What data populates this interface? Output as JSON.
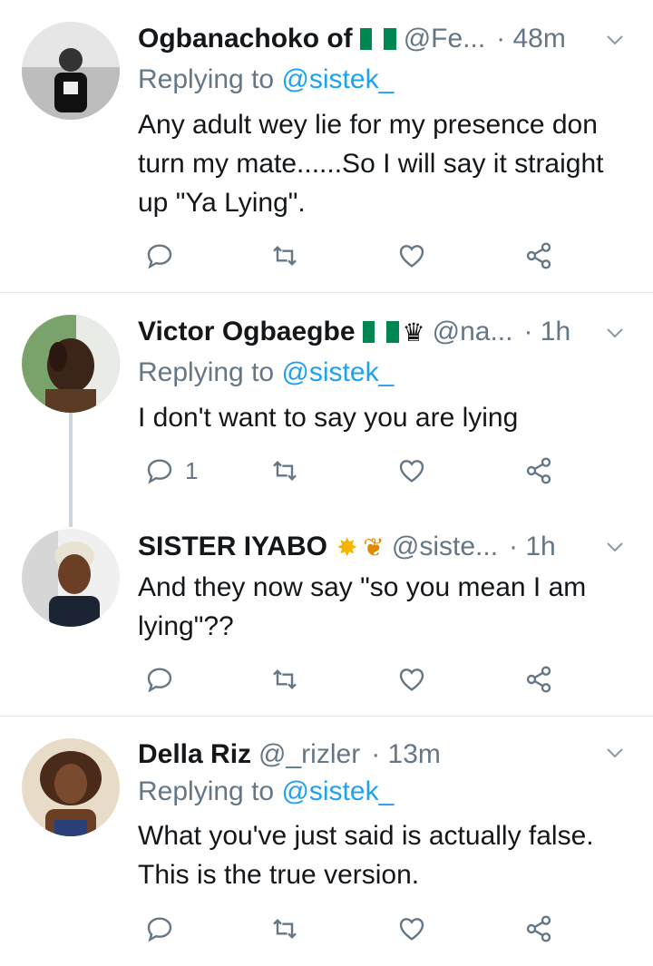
{
  "tweets": [
    {
      "name": "Ogbanachoko of",
      "handle": "@Fe...",
      "time": "· 48m",
      "reply_prefix": "Replying to",
      "reply_to": "@sistek_",
      "body": "Any adult wey lie for my presence don turn my mate......So I will say it straight up \"Ya Lying\".",
      "reply_count": ""
    },
    {
      "name": "Victor Ogbaegbe",
      "handle": "@na...",
      "time": "· 1h",
      "reply_prefix": "Replying to",
      "reply_to": "@sistek_",
      "body": "I don't want to say you are lying",
      "reply_count": "1"
    },
    {
      "name": "SISTER IYABO",
      "handle": "@siste...",
      "time": "· 1h",
      "body": "And they now say \"so you mean I am lying\"??",
      "reply_count": ""
    },
    {
      "name": "Della Riz",
      "handle": "@_rizler",
      "time": "· 13m",
      "reply_prefix": "Replying to",
      "reply_to": "@sistek_",
      "body": "What you've just said is actually false. This is the true version.",
      "reply_count": ""
    }
  ],
  "colors": {
    "text": "#14171a",
    "muted": "#657786",
    "link": "#1da1f2",
    "flag_green": "#008751",
    "divider": "#e1e8ed"
  },
  "icons": [
    "reply-icon",
    "retweet-icon",
    "like-icon",
    "share-icon",
    "chevron-down-icon",
    "nigeria-flag-icon",
    "crown-icon",
    "sparkle-star-icon",
    "butterfly-icon"
  ]
}
